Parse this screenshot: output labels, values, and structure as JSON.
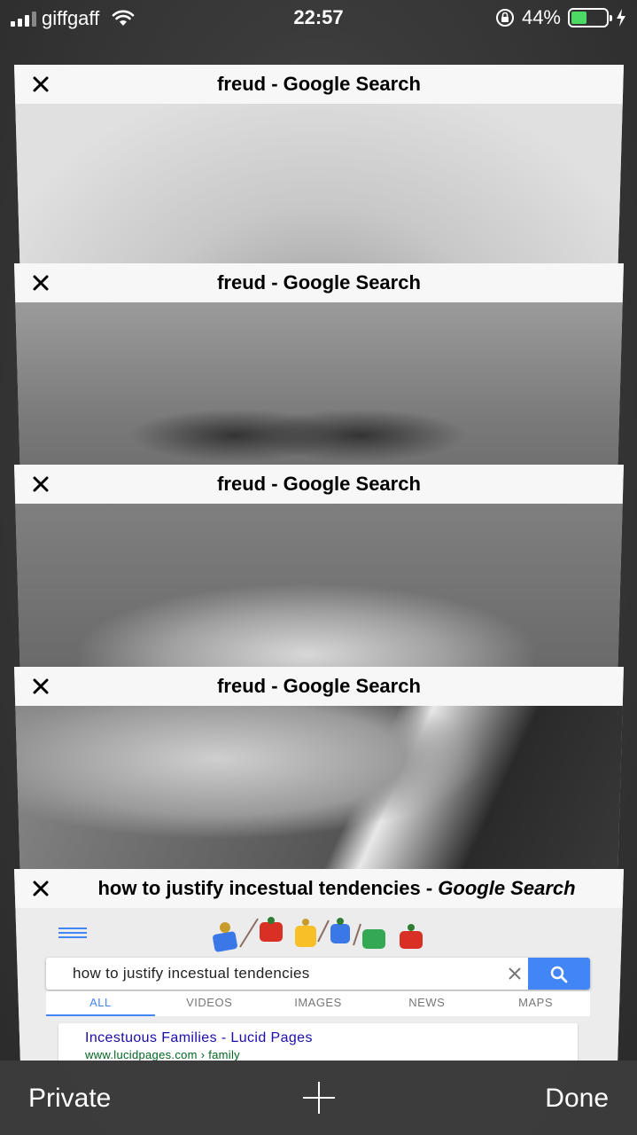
{
  "status_bar": {
    "carrier": "giffgaff",
    "time": "22:57",
    "battery_percent": "44%",
    "battery_level": 0.44,
    "battery_color": "#4cd964"
  },
  "tabs": [
    {
      "title": "freud - Google Search",
      "close_icon": "close-icon"
    },
    {
      "title": "freud - Google Search",
      "close_icon": "close-icon"
    },
    {
      "title": "freud - Google Search",
      "close_icon": "close-icon"
    },
    {
      "title": "freud - Google Search",
      "close_icon": "close-icon"
    },
    {
      "title_main": "how to justify incestual tendencies - ",
      "title_sub": "Google Search",
      "close_icon": "close-icon",
      "page": {
        "search_query": "how to justify incestual tendencies",
        "search_tabs": [
          "ALL",
          "VIDEOS",
          "IMAGES",
          "NEWS",
          "MAPS"
        ],
        "active_tab": "ALL",
        "result_title": "Incestuous Families - Lucid Pages",
        "result_url": "www.lucidpages.com › family",
        "accent": "#4285f4"
      }
    }
  ],
  "toolbar": {
    "private_label": "Private",
    "done_label": "Done",
    "new_tab_icon": "plus-icon"
  }
}
